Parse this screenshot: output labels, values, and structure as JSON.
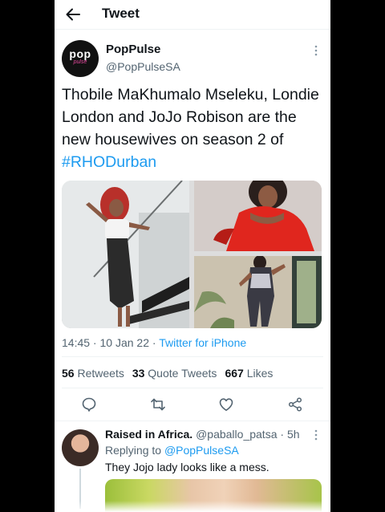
{
  "header": {
    "title": "Tweet"
  },
  "author": {
    "avatar_text": "pop",
    "avatar_sub": "pulse",
    "display_name": "PopPulse",
    "handle": "@PopPulseSA"
  },
  "tweet": {
    "text": "Thobile MaKhumalo Mseleku, Londie London and JoJo Robison are the new housewives on season 2 of ",
    "hashtag": "#RHODurban"
  },
  "meta": {
    "time": "14:45",
    "sep1": " · ",
    "date": "10 Jan 22",
    "sep2": " · ",
    "source": "Twitter for iPhone"
  },
  "stats": {
    "retweets_count": "56",
    "retweets_label": "Retweets",
    "quotes_count": "33",
    "quotes_label": "Quote Tweets",
    "likes_count": "667",
    "likes_label": "Likes"
  },
  "actions": [
    "reply-icon",
    "retweet-icon",
    "like-icon",
    "share-icon"
  ],
  "reply": {
    "name": "Raised in Africa.",
    "handle": "@paballo_patsa",
    "dot": " · ",
    "time": "5h",
    "replying_prefix": "Replying to ",
    "replying_user": "@PopPulseSA",
    "text": "They Jojo lady looks like a mess."
  },
  "colors": {
    "accent": "#1d9bf0",
    "text": "#0f1419",
    "secondary": "#536471",
    "background": "#ffffff"
  }
}
